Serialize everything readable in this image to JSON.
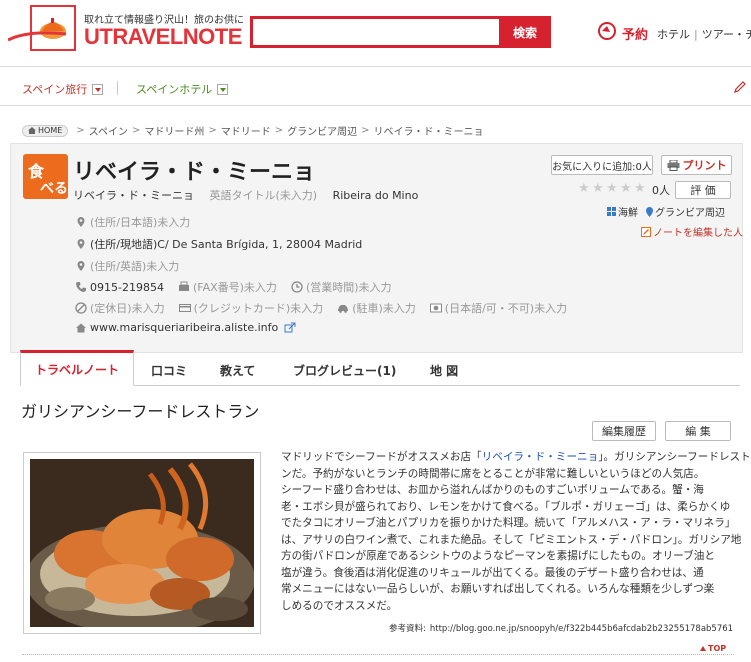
{
  "header": {
    "tagline": "取れ立て情報盛り沢山！旅のお供に",
    "logo": "UTRAVELNOTE",
    "search_placeholder": "",
    "search_button": "検索",
    "reserve_label": "予約",
    "nav_items": [
      "ホテル",
      "|",
      "ツアー・チ"
    ]
  },
  "subnav": {
    "items": [
      "スペイン旅行",
      "スペインホテル"
    ]
  },
  "breadcrumb": {
    "home": "HOME",
    "items": [
      "スペイン",
      "マドリード州",
      "マドリード",
      "グランビア周辺",
      "リベイラ・ド・ミーニョ"
    ]
  },
  "spot": {
    "category_char1": "食",
    "category_char2": "べる",
    "title": "リベイラ・ド・ミーニョ",
    "title_kana": "リベイラ・ド・ミーニョ",
    "title_en_placeholder": "英語タイトル(未入力)",
    "title_local": "Ribeira do Mino",
    "favorite_button": "お気に入りに追加:0人",
    "print_button": "プリント",
    "star_count": 0,
    "review_count": "0人",
    "rate_button": "評 価",
    "tag_category": "海鮮",
    "tag_area": "グランビア周辺",
    "edit_note_link": "ノートを編集した人",
    "address_ja": "(住所/日本語)未入力",
    "address_local": "(住所/現地語)C/ De Santa Brígida, 1, 28004 Madrid",
    "address_en": "(住所/英語)未入力",
    "phone": "0915-219854",
    "fax": "(FAX番号)未入力",
    "hours": "(営業時間)未入力",
    "closed": "(定休日)未入力",
    "credit": "(クレジットカード)未入力",
    "parking": "(駐車)未入力",
    "japanese": "(日本語/可・不可)未入力",
    "website": "www.marisqueriaribeira.aliste.info"
  },
  "tabs": [
    "トラベルノート",
    "口コミ",
    "教えて",
    "ブログレビュー(1)",
    "地 図"
  ],
  "article": {
    "title": "ガリシアンシーフードレストラン",
    "history_button": "編集履歴",
    "edit_button": "編 集",
    "line1_pre": "マドリッドでシーフードがオススメお店「",
    "line1_link": "リベイラ・ド・ミーニョ",
    "line1_post": "」。ガリシアンシーフードレストラ",
    "lines": [
      "ンだ。予約がないとランチの時間帯に席をとることが非常に難しいというほどの人気店。",
      "シーフード盛り合わせは、お皿から溢れんばかりのものすごいボリュームである。蟹・海",
      "老・エボシ貝が盛られており、レモンをかけて食べる。「ブルポ・ガリェーゴ」は、柔らかくゆ",
      "でたタコにオリーブ油とパプリカを振りかけた料理。続いて「アルメハス・ア・ラ・マリネラ」",
      "は、アサリの白ワイン煮で、これまた絶品。そして「ピミエントス・デ・パドロン」。ガリシア地",
      "方の街パドロンが原産であるシシトウのようなピーマンを素揚げにしたもの。オリーブ油と",
      "塩が違う。食後酒は消化促進のリキュールが出てくる。最後のデザート盛り合わせは、通",
      "常メニューにはない一品らしいが、お願いすれば出してくれる。いろんな種類を少しずつ楽",
      "しめるのでオススメだ。"
    ],
    "source_label": "参考資料:",
    "source_url": "http://blog.goo.ne.jp/snoopyh/e/f322b445b6afcdab2b23255178ab5761",
    "top_link": "TOP"
  }
}
